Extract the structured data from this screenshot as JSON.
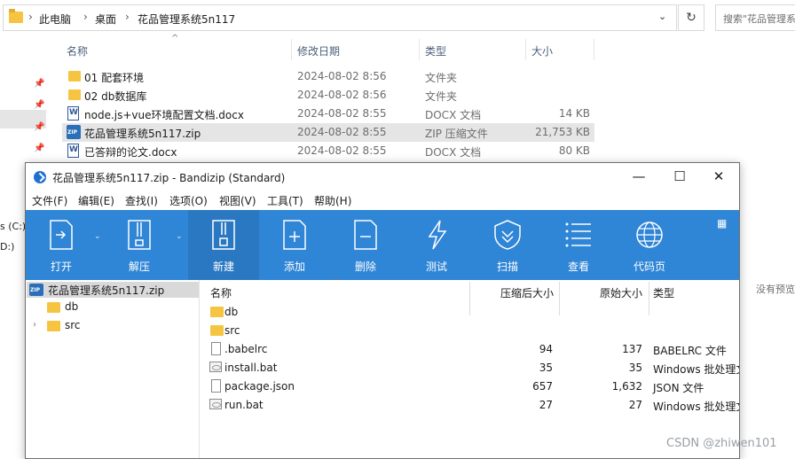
{
  "explorer": {
    "breadcrumb": [
      "此电脑",
      "桌面",
      "花品管理系统5n117"
    ],
    "search_placeholder": "搜索\"花品管理系",
    "columns": {
      "name": "名称",
      "date": "修改日期",
      "type": "类型",
      "size": "大小"
    },
    "files": [
      {
        "name": "01  配套环境",
        "date": "2024-08-02 8:56",
        "type": "文件夹",
        "size": "",
        "icon": "folder-icon"
      },
      {
        "name": "02 db数据库",
        "date": "2024-08-02 8:56",
        "type": "文件夹",
        "size": "",
        "icon": "folder-icon"
      },
      {
        "name": "node.js+vue环境配置文档.docx",
        "date": "2024-08-02 8:55",
        "type": "DOCX 文档",
        "size": "14 KB",
        "icon": "word-document-icon"
      },
      {
        "name": "花品管理系统5n117.zip",
        "date": "2024-08-02 8:55",
        "type": "ZIP 压缩文件",
        "size": "21,753 KB",
        "icon": "zip-archive-icon"
      },
      {
        "name": "已答辩的论文.docx",
        "date": "2024-08-02 8:55",
        "type": "DOCX 文档",
        "size": "80 KB",
        "icon": "word-document-icon"
      }
    ],
    "drive_labels": [
      "s (C:)",
      "D:)"
    ],
    "preview_note": "没有预览"
  },
  "bandizip": {
    "title": "花品管理系统5n117.zip - Bandizip (Standard)",
    "menu": [
      "文件(F)",
      "编辑(E)",
      "查找(I)",
      "选项(O)",
      "视图(V)",
      "工具(T)",
      "帮助(H)"
    ],
    "toolbar": [
      "打开",
      "解压",
      "新建",
      "添加",
      "删除",
      "测试",
      "扫描",
      "查看",
      "代码页"
    ],
    "tree": {
      "root": "花品管理系统5n117.zip",
      "children": [
        "db",
        "src"
      ]
    },
    "list_columns": {
      "name": "名称",
      "packed": "压缩后大小",
      "original": "原始大小",
      "type": "类型"
    },
    "entries": [
      {
        "name": "db",
        "packed": "",
        "original": "",
        "type": "",
        "icon": "folder-icon"
      },
      {
        "name": "src",
        "packed": "",
        "original": "",
        "type": "",
        "icon": "folder-icon"
      },
      {
        "name": ".babelrc",
        "packed": "94",
        "original": "137",
        "type": "BABELRC 文件",
        "icon": "file-icon"
      },
      {
        "name": "install.bat",
        "packed": "35",
        "original": "35",
        "type": "Windows 批处理文件",
        "icon": "batch-file-icon"
      },
      {
        "name": "package.json",
        "packed": "657",
        "original": "1,632",
        "type": "JSON 文件",
        "icon": "file-icon"
      },
      {
        "name": "run.bat",
        "packed": "27",
        "original": "27",
        "type": "Windows 批处理文件",
        "icon": "batch-file-icon"
      }
    ]
  },
  "watermark": "CSDN @zhiwen101"
}
